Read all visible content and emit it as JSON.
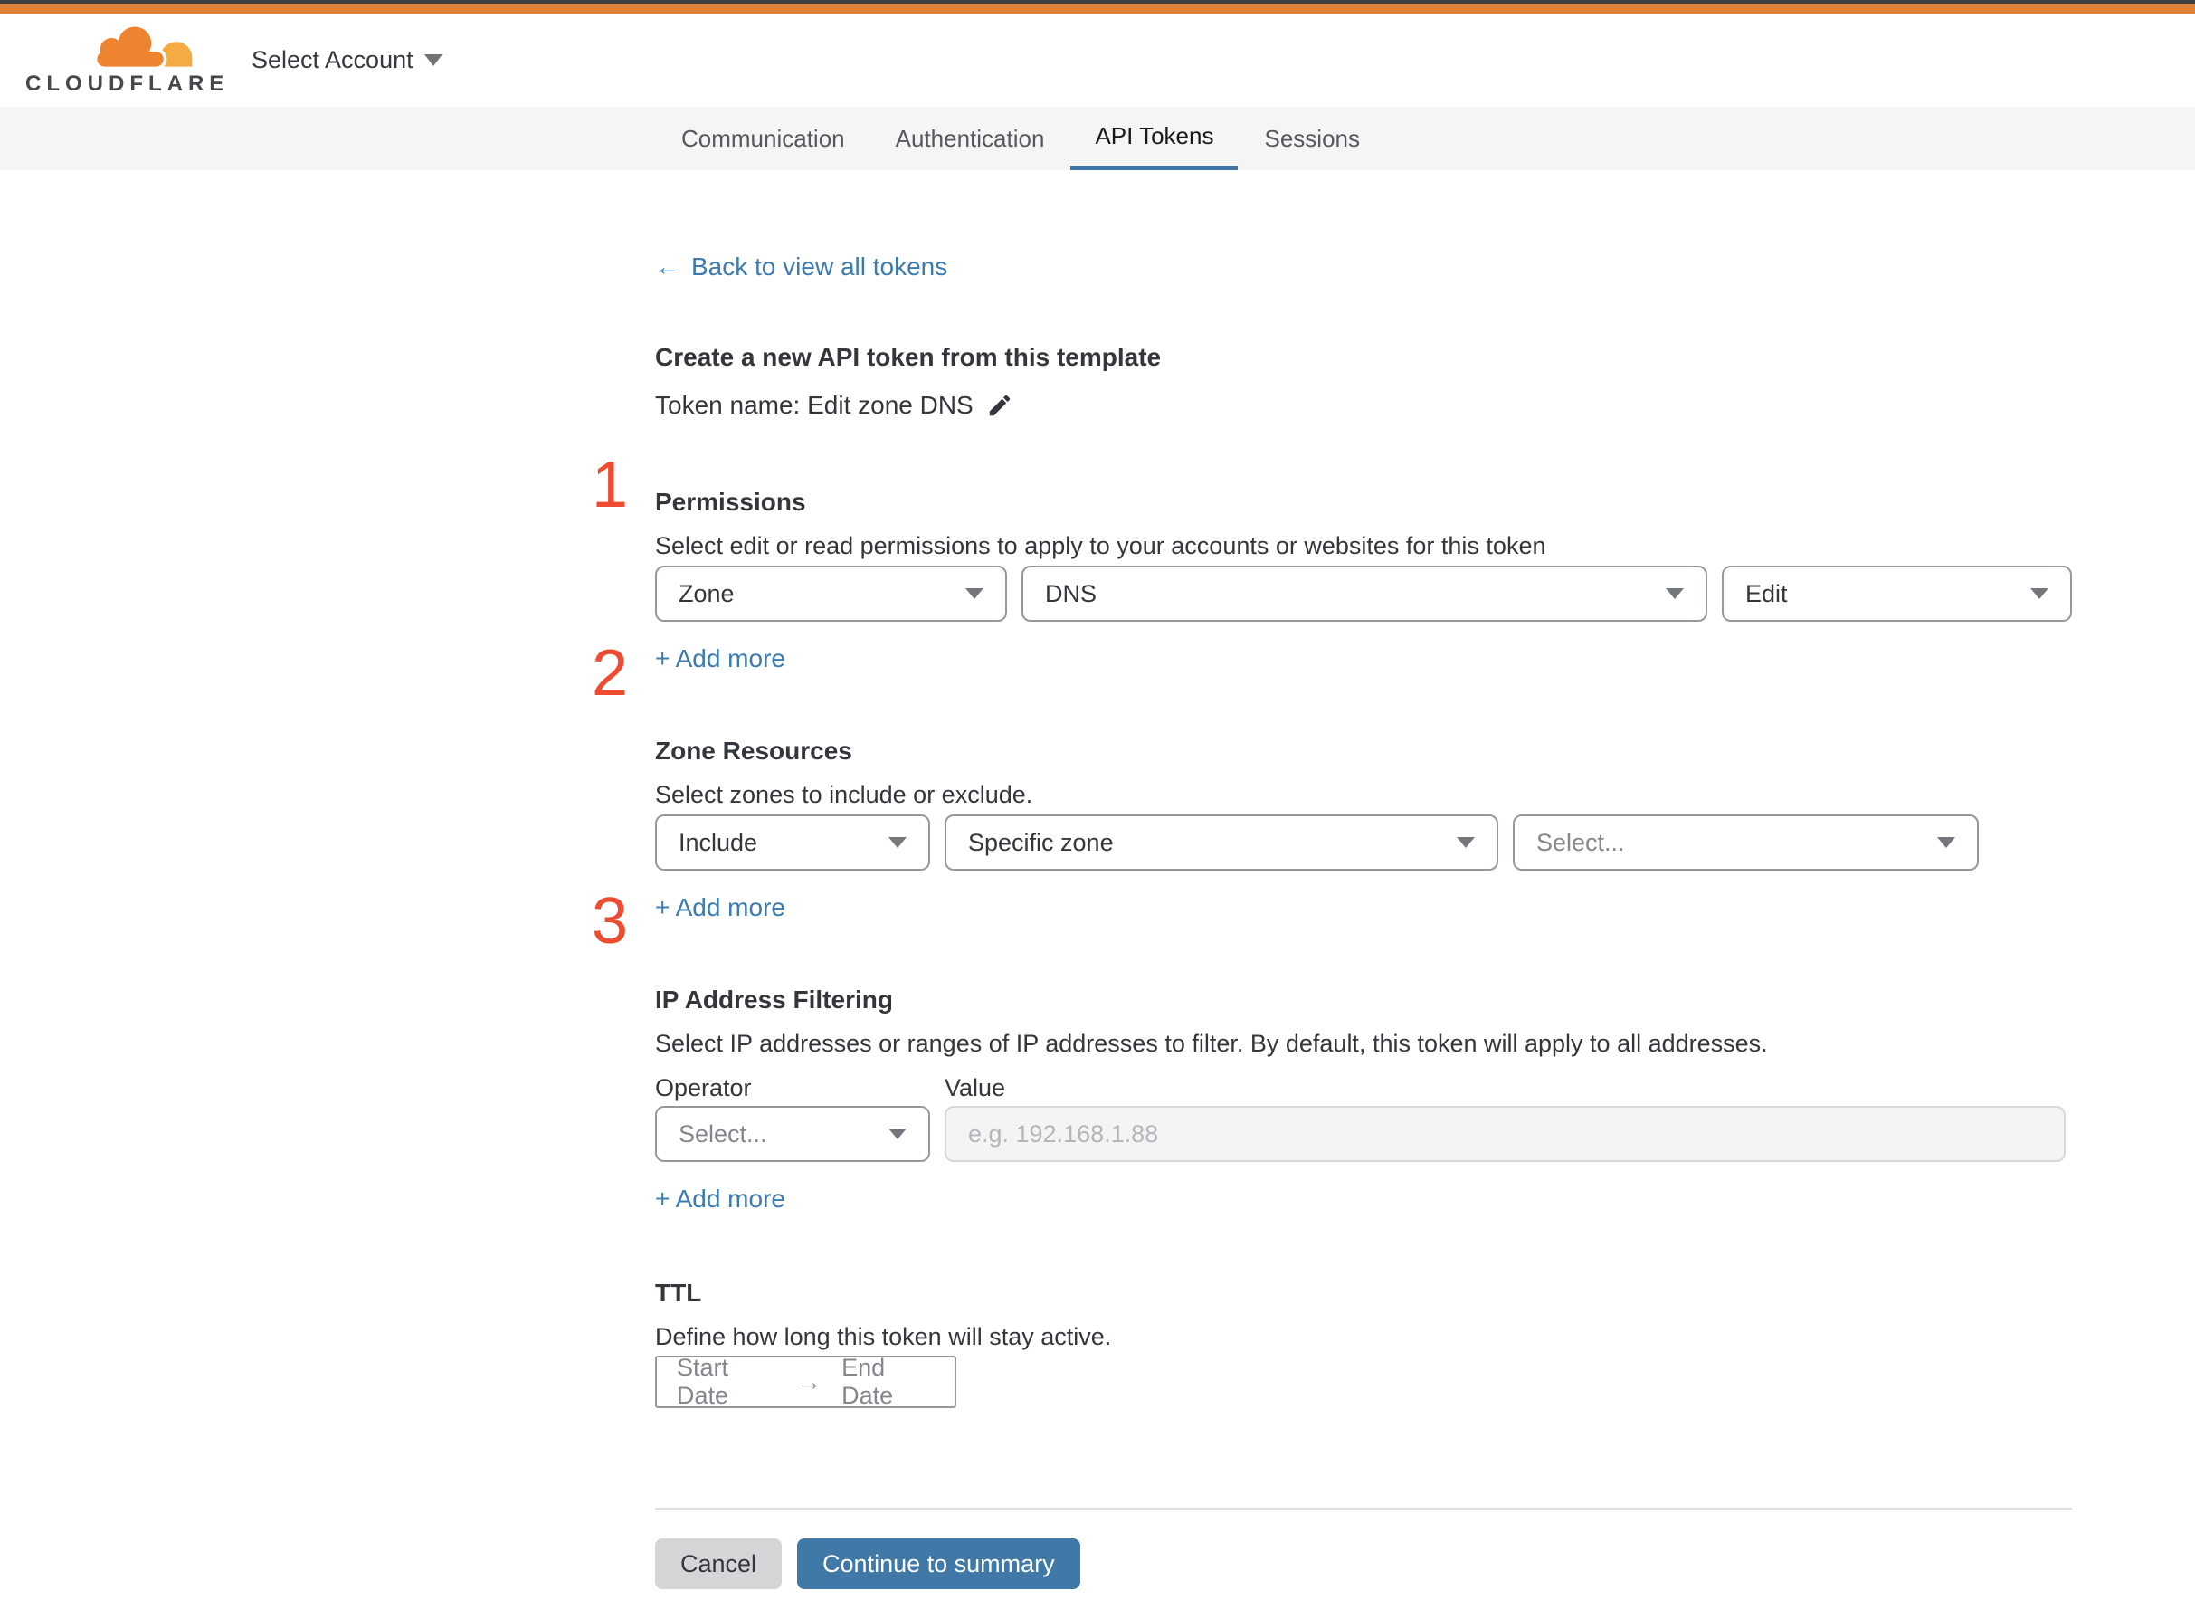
{
  "header": {
    "logo_text": "CLOUDFLARE",
    "account_selector_label": "Select Account"
  },
  "tabs": {
    "items": [
      {
        "label": "Communication",
        "active": false
      },
      {
        "label": "Authentication",
        "active": false
      },
      {
        "label": "API Tokens",
        "active": true
      },
      {
        "label": "Sessions",
        "active": false
      }
    ]
  },
  "content": {
    "back_link": {
      "arrow": "←",
      "label": "Back to view all tokens"
    },
    "template_section": {
      "step": "1",
      "heading": "Create a new API token from this template",
      "token_line": "Token name: Edit zone DNS"
    },
    "permissions": {
      "step": "2",
      "heading": "Permissions",
      "description": "Select edit or read permissions to apply to your accounts or websites for this token",
      "scope_value": "Zone",
      "service_value": "DNS",
      "access_value": "Edit",
      "add_more_label": "+ Add more"
    },
    "zone_resources": {
      "step": "3",
      "heading": "Zone Resources",
      "description": "Select zones to include or exclude.",
      "mode_value": "Include",
      "type_value": "Specific zone",
      "zone_placeholder": "Select...",
      "add_more_label": "+ Add more"
    },
    "ip_filtering": {
      "heading": "IP Address Filtering",
      "description": "Select IP addresses or ranges of IP addresses to filter. By default, this token will apply to all addresses.",
      "operator_label": "Operator",
      "value_label": "Value",
      "operator_placeholder": "Select...",
      "value_placeholder": "e.g. 192.168.1.88",
      "add_more_label": "+ Add more"
    },
    "ttl": {
      "heading": "TTL",
      "description": "Define how long this token will stay active.",
      "start_placeholder": "Start Date",
      "arrow": "→",
      "end_placeholder": "End Date"
    },
    "footer": {
      "cancel_label": "Cancel",
      "continue_label": "Continue to summary"
    }
  },
  "colors": {
    "top_bar_orange": "#e0813a",
    "brand_cloud_orange": "#ee8330",
    "brand_cloud_light": "#f5ab43",
    "step_number_red": "#ee4c31",
    "link_blue": "#3b7bb0",
    "tab_underline_blue": "#3e74a5",
    "continue_button_blue": "#4079a8"
  }
}
